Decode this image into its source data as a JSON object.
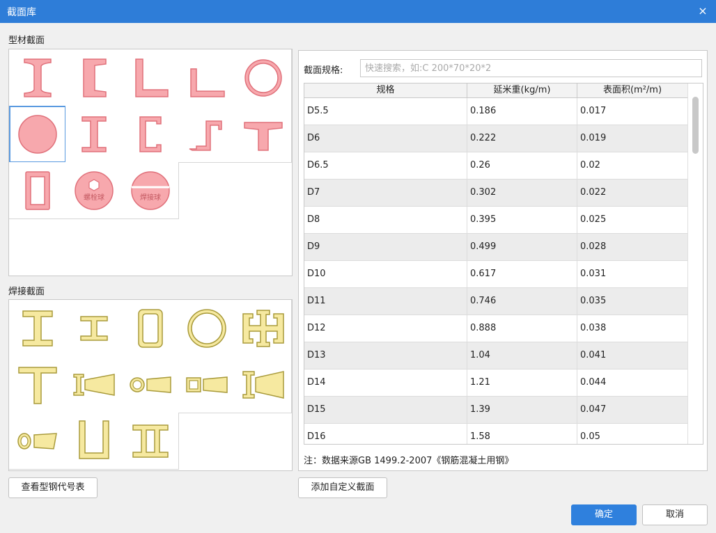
{
  "window": {
    "title": "截面库",
    "close_symbol": "×"
  },
  "profile_section": {
    "label": "型材截面"
  },
  "weld_section": {
    "label": "焊接截面"
  },
  "profile_items": [
    {
      "name": "i-beam"
    },
    {
      "name": "channel"
    },
    {
      "name": "equal-angle"
    },
    {
      "name": "unequal-angle"
    },
    {
      "name": "pipe"
    },
    {
      "name": "round-bar"
    },
    {
      "name": "cold-formed-i"
    },
    {
      "name": "cold-formed-channel"
    },
    {
      "name": "z-section"
    },
    {
      "name": "t-section"
    },
    {
      "name": "rectangular-tube"
    },
    {
      "name": "bolt-ball",
      "text": "螺栓球"
    },
    {
      "name": "weld-ball",
      "text": "焊接球"
    }
  ],
  "weld_items": [
    {
      "name": "weld-h"
    },
    {
      "name": "weld-h-narrow"
    },
    {
      "name": "weld-box"
    },
    {
      "name": "weld-pipe"
    },
    {
      "name": "weld-cross"
    },
    {
      "name": "weld-t"
    },
    {
      "name": "weld-tapered-i"
    },
    {
      "name": "weld-pipe-tapered"
    },
    {
      "name": "weld-box-tapered"
    },
    {
      "name": "weld-tapered-i-2"
    },
    {
      "name": "weld-pipe-taper-2"
    },
    {
      "name": "weld-u"
    },
    {
      "name": "weld-double-i"
    }
  ],
  "search": {
    "label": "截面规格:",
    "placeholder": "快速搜索，如:C 200*70*20*2",
    "value": ""
  },
  "table": {
    "headers": [
      "规格",
      "延米重(kg/m)",
      "表面积(m²/m)"
    ],
    "rows": [
      [
        "D5.5",
        "0.186",
        "0.017"
      ],
      [
        "D6",
        "0.222",
        "0.019"
      ],
      [
        "D6.5",
        "0.26",
        "0.02"
      ],
      [
        "D7",
        "0.302",
        "0.022"
      ],
      [
        "D8",
        "0.395",
        "0.025"
      ],
      [
        "D9",
        "0.499",
        "0.028"
      ],
      [
        "D10",
        "0.617",
        "0.031"
      ],
      [
        "D11",
        "0.746",
        "0.035"
      ],
      [
        "D12",
        "0.888",
        "0.038"
      ],
      [
        "D13",
        "1.04",
        "0.041"
      ],
      [
        "D14",
        "1.21",
        "0.044"
      ],
      [
        "D15",
        "1.39",
        "0.047"
      ],
      [
        "D16",
        "1.58",
        "0.05"
      ]
    ]
  },
  "note": "注：数据来源GB 1499.2-2007《钢筋混凝土用钢》",
  "buttons": {
    "view_code": "查看型钢代号表",
    "add_custom": "添加自定义截面",
    "ok": "确定",
    "cancel": "取消"
  },
  "colors": {
    "titlebar": "#2e7dd8",
    "profile_fill": "#f7a8ad",
    "profile_stroke": "#e0707a",
    "weld_fill": "#f6e9a0",
    "weld_stroke": "#a89a3a",
    "primary": "#2f80dd"
  }
}
